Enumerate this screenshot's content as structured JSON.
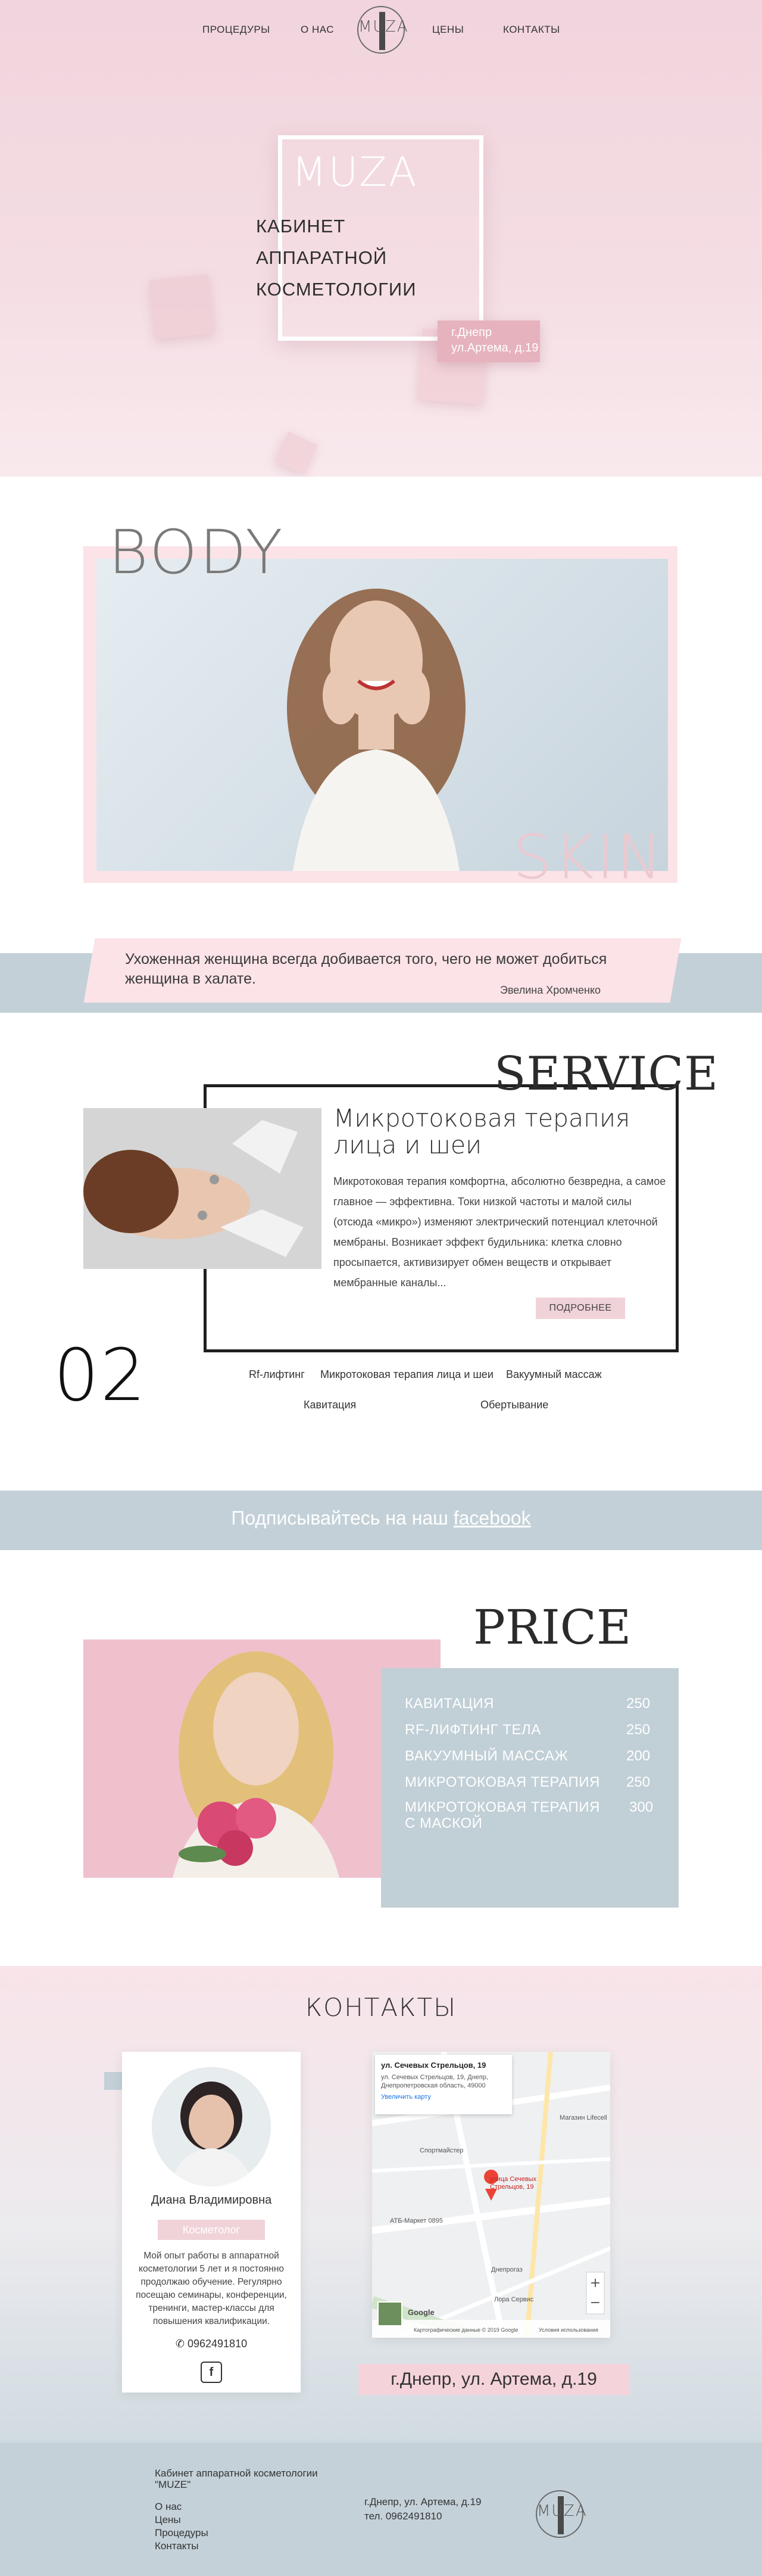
{
  "nav": {
    "procedures": "ПРОЦЕДУРЫ",
    "about": "О НАС",
    "prices": "ЦЕНЫ",
    "contacts": "КОНТАКТЫ",
    "logo": "MUZA"
  },
  "hero": {
    "brand": "MUZA",
    "line1": "КАБИНЕТ",
    "line2": "АППАРАТНОЙ",
    "line3": "КОСМЕТОЛОГИИ",
    "addr1": "г.Днепр",
    "addr2": "ул.Артема, д.19"
  },
  "banner": {
    "word_body": "BODY",
    "word_skin": "SKIN"
  },
  "quote": {
    "text": "Ухоженная женщина всегда добивается того, чего не может добиться женщина в халате.",
    "author": "Эвелина Хромченко"
  },
  "service": {
    "title": "SERVICE",
    "name": "Микротоковая терапия лица и шеи",
    "description": "Микротоковая терапия комфортна, абсолютно безвредна, а самое главное — эффективна. Токи низкой частоты и малой силы (отсюда «микро») изменяют электрический потенциал клеточной мембраны. Возникает эффект будильника: клетка словно просыпается, активизирует обмен веществ и открывает мембранные каналы...",
    "more_label": "ПОДРОБНЕЕ",
    "slide_number": "02",
    "tabs": [
      "Rf-лифтинг",
      "Микротоковая терапия лица и шеи",
      "Вакуумный массаж",
      "Кавитация",
      "Обертывание"
    ]
  },
  "facebook_band": {
    "text": "Подписывайтесь на наш ",
    "link": "facebook"
  },
  "price": {
    "title": "PRICE",
    "items": [
      {
        "name": "КАВИТАЦИЯ",
        "value": "250"
      },
      {
        "name": "RF-ЛИФТИНГ ТЕЛА",
        "value": "250"
      },
      {
        "name": "ВАКУУМНЫЙ МАССАЖ",
        "value": "200"
      },
      {
        "name": "МИКРОТОКОВАЯ ТЕРАПИЯ",
        "value": "250"
      },
      {
        "name": "МИКРОТОКОВАЯ ТЕРАПИЯ С МАСКОЙ",
        "value": "300"
      }
    ]
  },
  "contacts": {
    "title": "КОНТАКТЫ",
    "staff_name": "Диана Владимировна",
    "staff_role": "Косметолог",
    "staff_bio": "Мой опыт работы в аппаратной косметологии 5 лет и я постоянно продолжаю обучение. Регулярно посещаю семинары, конференции, тренинги, мастер-классы для повышения квалификации.",
    "phone": "0962491810",
    "fb_icon": "facebook-icon",
    "address_badge": "г.Днепр, ул. Артема, д.19",
    "map": {
      "place_title": "ул. Сечевых Стрельцов, 19",
      "place_address": "ул. Сечевых Стрельцов, 19, Днепр, Днепропетровская область, 49000",
      "enlarge": "Увеличить карту",
      "marker_label": "улица Сечевых Стрельцов, 19",
      "poi": [
        "Магазин Lifecell",
        "Спортмайстер",
        "АТБ-Маркет 0895",
        "Днепрогаз",
        "Лора Сервис"
      ],
      "footer_data": "Картографические данные © 2019 Google",
      "footer_terms": "Условия использования",
      "google": "Google"
    }
  },
  "footer": {
    "company": "Кабинет аппаратной косметологии \"MUZE\"",
    "links": [
      "О нас",
      "Цены",
      "Процедуры",
      "Контакты"
    ],
    "address": "г.Днепр, ул. Артема, д.19",
    "phone": "тел. 0962491810",
    "logo": "MUZA"
  },
  "colors": {
    "pink": "#f1d4dd",
    "accent_pink": "#e6b2bd",
    "blue_gray": "#c3d0d7"
  }
}
